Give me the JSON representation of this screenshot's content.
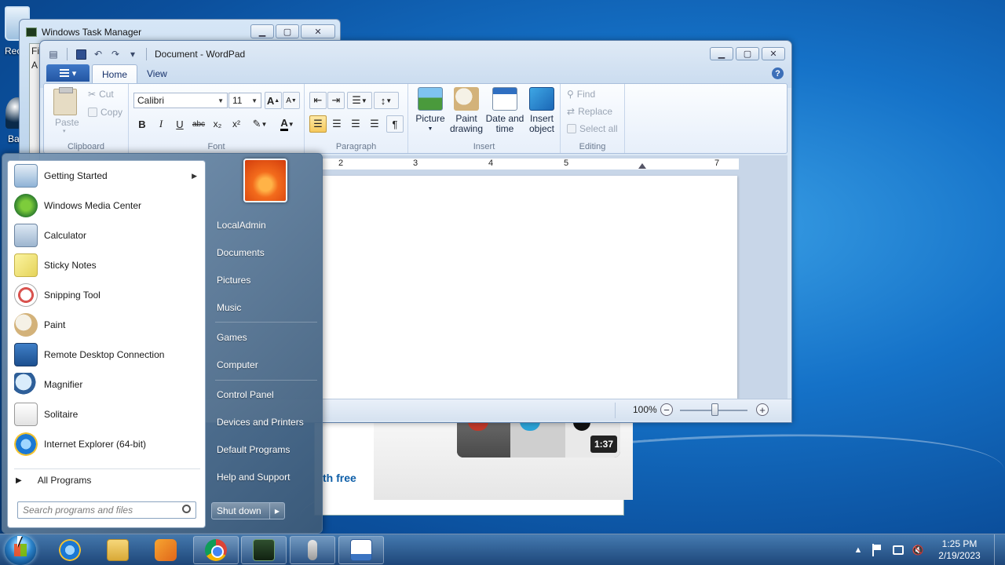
{
  "desktop": {
    "icons": [
      {
        "label": "Rec",
        "icon": "recycle-bin-icon"
      },
      {
        "label": "Ba",
        "icon": "backup-icon"
      }
    ]
  },
  "task_manager": {
    "title": "Windows Task Manager",
    "menu_fragment": "Fil",
    "tab_fragment": "A"
  },
  "background_page": {
    "video_duration": "1:37",
    "link_fragment": "th free"
  },
  "wordpad": {
    "title": "Document - WordPad",
    "tabs": [
      {
        "label": "Home",
        "active": true
      },
      {
        "label": "View",
        "active": false
      }
    ],
    "help_label": "?",
    "clipboard": {
      "paste": "Paste",
      "cut": "Cut",
      "copy": "Copy",
      "group_label": "Clipboard"
    },
    "font": {
      "family": "Calibri",
      "size": "11",
      "grow": "A",
      "shrink": "A",
      "bold": "B",
      "italic": "I",
      "underline": "U",
      "strike": "abc",
      "subscript": "x₂",
      "superscript": "x²",
      "color": "A",
      "group_label": "Font"
    },
    "paragraph": {
      "group_label": "Paragraph"
    },
    "insert": {
      "picture": "Picture",
      "paint_drawing_1": "Paint",
      "paint_drawing_2": "drawing",
      "date_time_1": "Date and",
      "date_time_2": "time",
      "insert_object_1": "Insert",
      "insert_object_2": "object",
      "group_label": "Insert"
    },
    "editing": {
      "find": "Find",
      "replace": "Replace",
      "select_all": "Select all",
      "group_label": "Editing"
    },
    "ruler_numbers": [
      "2",
      "3",
      "4",
      "5",
      "7"
    ],
    "status": {
      "zoom": "100%",
      "zoom_out": "−",
      "zoom_in": "+"
    }
  },
  "start_menu": {
    "programs": [
      {
        "label": "Getting Started",
        "icon": "getting-started-icon",
        "has_submenu": true
      },
      {
        "label": "Windows Media Center",
        "icon": "media-center-icon"
      },
      {
        "label": "Calculator",
        "icon": "calculator-icon"
      },
      {
        "label": "Sticky Notes",
        "icon": "sticky-notes-icon"
      },
      {
        "label": "Snipping Tool",
        "icon": "snipping-tool-icon"
      },
      {
        "label": "Paint",
        "icon": "paint-icon"
      },
      {
        "label": "Remote Desktop Connection",
        "icon": "remote-desktop-icon"
      },
      {
        "label": "Magnifier",
        "icon": "magnifier-icon"
      },
      {
        "label": "Solitaire",
        "icon": "solitaire-icon"
      },
      {
        "label": "Internet Explorer (64-bit)",
        "icon": "internet-explorer-icon"
      }
    ],
    "all_programs": "All Programs",
    "search_placeholder": "Search programs and files",
    "right_links": [
      "LocalAdmin",
      "Documents",
      "Pictures",
      "Music",
      "Games",
      "Computer",
      "Control Panel",
      "Devices and Printers",
      "Default Programs",
      "Help and Support"
    ],
    "shutdown": "Shut down"
  },
  "taskbar": {
    "pinned": [
      {
        "name": "internet-explorer",
        "icon": "internet-explorer-icon",
        "open": false
      },
      {
        "name": "windows-explorer",
        "icon": "folder-icon",
        "open": false
      },
      {
        "name": "media-player",
        "icon": "media-player-icon",
        "open": false
      },
      {
        "name": "chrome",
        "icon": "chrome-icon",
        "open": true
      },
      {
        "name": "task-manager",
        "icon": "task-manager-icon",
        "open": true
      },
      {
        "name": "speech",
        "icon": "microphone-icon",
        "open": true
      },
      {
        "name": "wordpad",
        "icon": "wordpad-icon",
        "open": true
      }
    ],
    "time": "1:25 PM",
    "date": "2/19/2023"
  }
}
